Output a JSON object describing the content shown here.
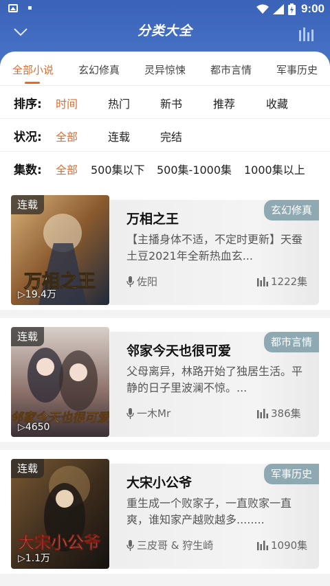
{
  "status_bar": {
    "time": "9:00"
  },
  "header": {
    "title": "分类大全"
  },
  "tabs": [
    {
      "label": "全部小说",
      "active": true
    },
    {
      "label": "玄幻修真",
      "active": false
    },
    {
      "label": "灵异惊悚",
      "active": false
    },
    {
      "label": "都市言情",
      "active": false
    },
    {
      "label": "军事历史",
      "active": false
    }
  ],
  "filters": {
    "sort": {
      "label": "排序:",
      "options": [
        "时间",
        "热门",
        "新书",
        "推荐",
        "收藏"
      ],
      "selected": "时间"
    },
    "status": {
      "label": "状况:",
      "options": [
        "全部",
        "连载",
        "完结"
      ],
      "selected": "全部"
    },
    "episodes": {
      "label": "集数:",
      "options": [
        "全部",
        "500集以下",
        "500集-1000集",
        "1000集以上"
      ],
      "selected": "全部"
    }
  },
  "books": [
    {
      "title": "万相之王",
      "category": "玄幻修真",
      "status_badge": "连载",
      "plays": "19.4万",
      "description": "【主播身体不适，不定时更新】天蚕土豆2021年全新热血玄...",
      "author": "佐阳",
      "episodes": "1222集",
      "cover_text": "万相之王",
      "cover_colors": [
        "#6b4a2a",
        "#c98b3a",
        "#2b3f5a"
      ]
    },
    {
      "title": "邻家今天也很可爱",
      "category": "都市言情",
      "status_badge": "连载",
      "plays": "4650",
      "description": "父母离异，林路开始了独居生活。平静的日子里波澜不惊。...",
      "author": "一木Mr",
      "episodes": "386集",
      "cover_text": "邻家今天也很可爱",
      "cover_colors": [
        "#c9b8b0",
        "#8a6a60",
        "#3a3340"
      ]
    },
    {
      "title": "大宋小公爷",
      "category": "军事历史",
      "status_badge": "连载",
      "plays": "1.1万",
      "description": "重生成一个败家子，一直败家一直爽，谁知家产越败越多........",
      "author": "三皮哥 & 狩生崎",
      "episodes": "1090集",
      "cover_text": "大宋小公爷",
      "cover_colors": [
        "#4a3520",
        "#a37a3c",
        "#1e1a16"
      ]
    }
  ],
  "colors": {
    "accent": "#e06a2d",
    "header": "#3f6abd",
    "tag": "#8fa9b3"
  }
}
